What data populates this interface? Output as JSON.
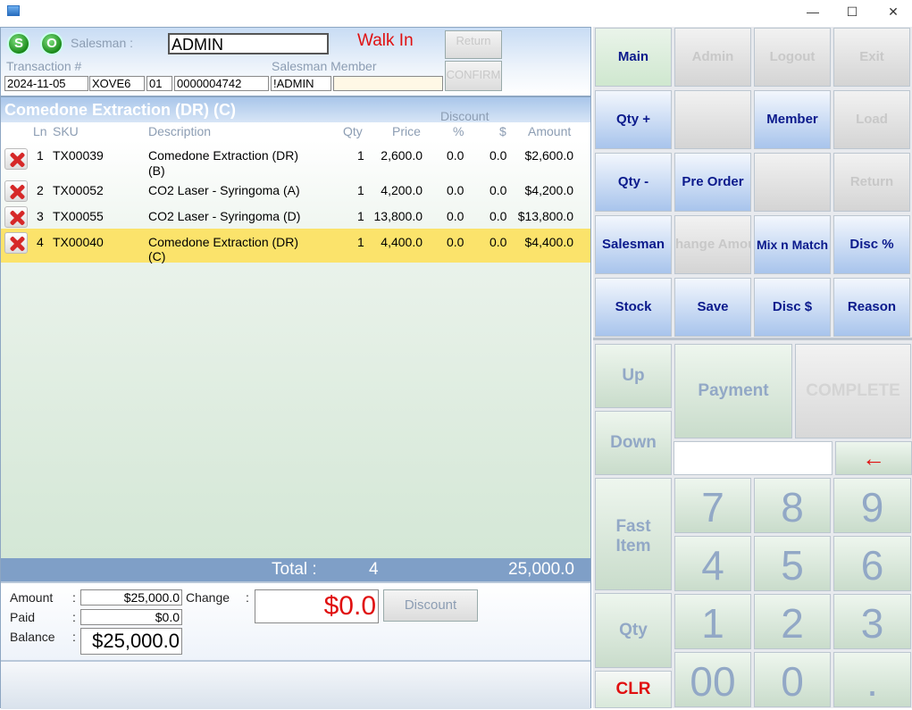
{
  "header": {
    "s_label": "S",
    "o_label": "O",
    "salesman_label": "Salesman :",
    "salesman_value": "ADMIN",
    "walk_in": "Walk In",
    "transaction_label": "Transaction #",
    "salesman_member_label": "Salesman Member",
    "date": "2024-11-05",
    "store": "XOVE6",
    "terminal": "01",
    "txn_no": "0000004742",
    "member": "!ADMIN",
    "return_label": "Return",
    "confirm_label": "CONFIRM"
  },
  "selected_item": "Comedone Extraction (DR) (C)",
  "columns": {
    "discount": "Discount",
    "ln": "Ln",
    "sku": "SKU",
    "description": "Description",
    "qty": "Qty",
    "price": "Price",
    "pct": "%",
    "dollar": "$",
    "amount": "Amount"
  },
  "rows": [
    {
      "ln": "1",
      "sku": "TX00039",
      "desc1": "Comedone Extraction (DR)",
      "desc2": "(B)",
      "qty": "1",
      "price": "2,600.0",
      "pct": "0.0",
      "dollar": "0.0",
      "amount": "$2,600.0"
    },
    {
      "ln": "2",
      "sku": "TX00052",
      "desc1": "CO2 Laser - Syringoma (A)",
      "desc2": "",
      "qty": "1",
      "price": "4,200.0",
      "pct": "0.0",
      "dollar": "0.0",
      "amount": "$4,200.0"
    },
    {
      "ln": "3",
      "sku": "TX00055",
      "desc1": "CO2 Laser - Syringoma (D)",
      "desc2": "",
      "qty": "1",
      "price": "13,800.0",
      "pct": "0.0",
      "dollar": "0.0",
      "amount": "$13,800.0"
    },
    {
      "ln": "4",
      "sku": "TX00040",
      "desc1": "Comedone Extraction (DR)",
      "desc2": "(C)",
      "qty": "1",
      "price": "4,400.0",
      "pct": "0.0",
      "dollar": "0.0",
      "amount": "$4,400.0"
    }
  ],
  "totals": {
    "label": "Total :",
    "qty": "4",
    "amount": "25,000.0"
  },
  "payment": {
    "amount_label": "Amount",
    "paid_label": "Paid",
    "balance_label": "Balance",
    "colon": ":",
    "amount": "$25,000.0",
    "paid": "$0.0",
    "balance": "$25,000.0",
    "change_label": "Change",
    "change": "$0.0",
    "discount_btn": "Discount"
  },
  "functions": {
    "main": "Main",
    "admin": "Admin",
    "logout": "Logout",
    "exit": "Exit",
    "qty_plus": "Qty +",
    "member": "Member",
    "load": "Load",
    "qty_minus": "Qty -",
    "pre_order": "Pre Order",
    "return": "Return",
    "salesman": "Salesman",
    "change_amount": "hange Amou",
    "mix_match": "Mix n Match",
    "disc_pct": "Disc %",
    "stock": "Stock",
    "save": "Save",
    "disc_dollar": "Disc $",
    "reason": "Reason"
  },
  "keypad": {
    "up": "Up",
    "down": "Down",
    "payment": "Payment",
    "complete": "COMPLETE",
    "back_arrow": "←",
    "fast1": "Fast",
    "fast2": "Item",
    "qty": "Qty",
    "clr": "CLR",
    "k7": "7",
    "k8": "8",
    "k9": "9",
    "k4": "4",
    "k5": "5",
    "k6": "6",
    "k1": "1",
    "k2": "2",
    "k3": "3",
    "k00": "00",
    "k0": "0",
    "kdot": "."
  },
  "window": {
    "minimize": "—",
    "maximize": "☐",
    "close": "✕"
  },
  "colors": {
    "accent_red": "#e01010",
    "highlight_row": "#fbe36b",
    "total_bar": "#7f9fc7",
    "clr_red": "#e01010"
  }
}
